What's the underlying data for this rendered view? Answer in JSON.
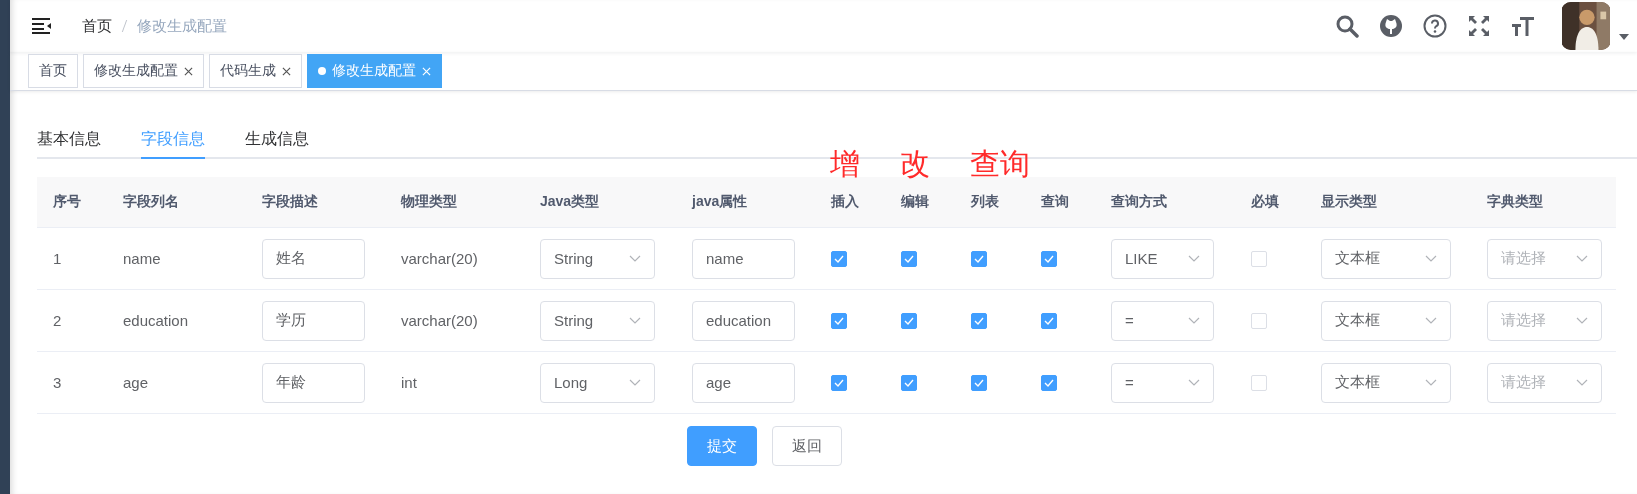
{
  "breadcrumb": [
    {
      "label": "首页",
      "current": false
    },
    {
      "label": "修改生成配置",
      "current": true
    }
  ],
  "tags": [
    {
      "label": "首页",
      "closable": false,
      "selected": false
    },
    {
      "label": "修改生成配置",
      "closable": true,
      "selected": false
    },
    {
      "label": "代码生成",
      "closable": true,
      "selected": false
    },
    {
      "label": "修改生成配置",
      "closable": true,
      "selected": true
    }
  ],
  "tabs": [
    {
      "label": "基本信息",
      "selected": false
    },
    {
      "label": "字段信息",
      "selected": true
    },
    {
      "label": "生成信息",
      "selected": false
    }
  ],
  "annotations": [
    {
      "text": "增"
    },
    {
      "text": "改"
    },
    {
      "text": "查询"
    }
  ],
  "table": {
    "columns": [
      "序号",
      "字段列名",
      "字段描述",
      "物理类型",
      "Java类型",
      "java属性",
      "插入",
      "编辑",
      "列表",
      "查询",
      "查询方式",
      "必填",
      "显示类型",
      "字典类型"
    ],
    "rows": [
      {
        "index": "1",
        "column_name": "name",
        "description": "姓名",
        "physical_type": "varchar(20)",
        "java_type": "String",
        "java_field": "name",
        "insert": true,
        "edit": true,
        "list": true,
        "query": true,
        "query_type": "LIKE",
        "required": false,
        "html_type": "文本框",
        "dict_type_placeholder": "请选择"
      },
      {
        "index": "2",
        "column_name": "education",
        "description": "学历",
        "physical_type": "varchar(20)",
        "java_type": "String",
        "java_field": "education",
        "insert": true,
        "edit": true,
        "list": true,
        "query": true,
        "query_type": "=",
        "required": false,
        "html_type": "文本框",
        "dict_type_placeholder": "请选择"
      },
      {
        "index": "3",
        "column_name": "age",
        "description": "年龄",
        "physical_type": "int",
        "java_type": "Long",
        "java_field": "age",
        "insert": true,
        "edit": true,
        "list": true,
        "query": true,
        "query_type": "=",
        "required": false,
        "html_type": "文本框",
        "dict_type_placeholder": "请选择"
      }
    ]
  },
  "buttons": [
    {
      "label": "提交",
      "kind": "primary"
    },
    {
      "label": "返回",
      "kind": "default"
    }
  ]
}
